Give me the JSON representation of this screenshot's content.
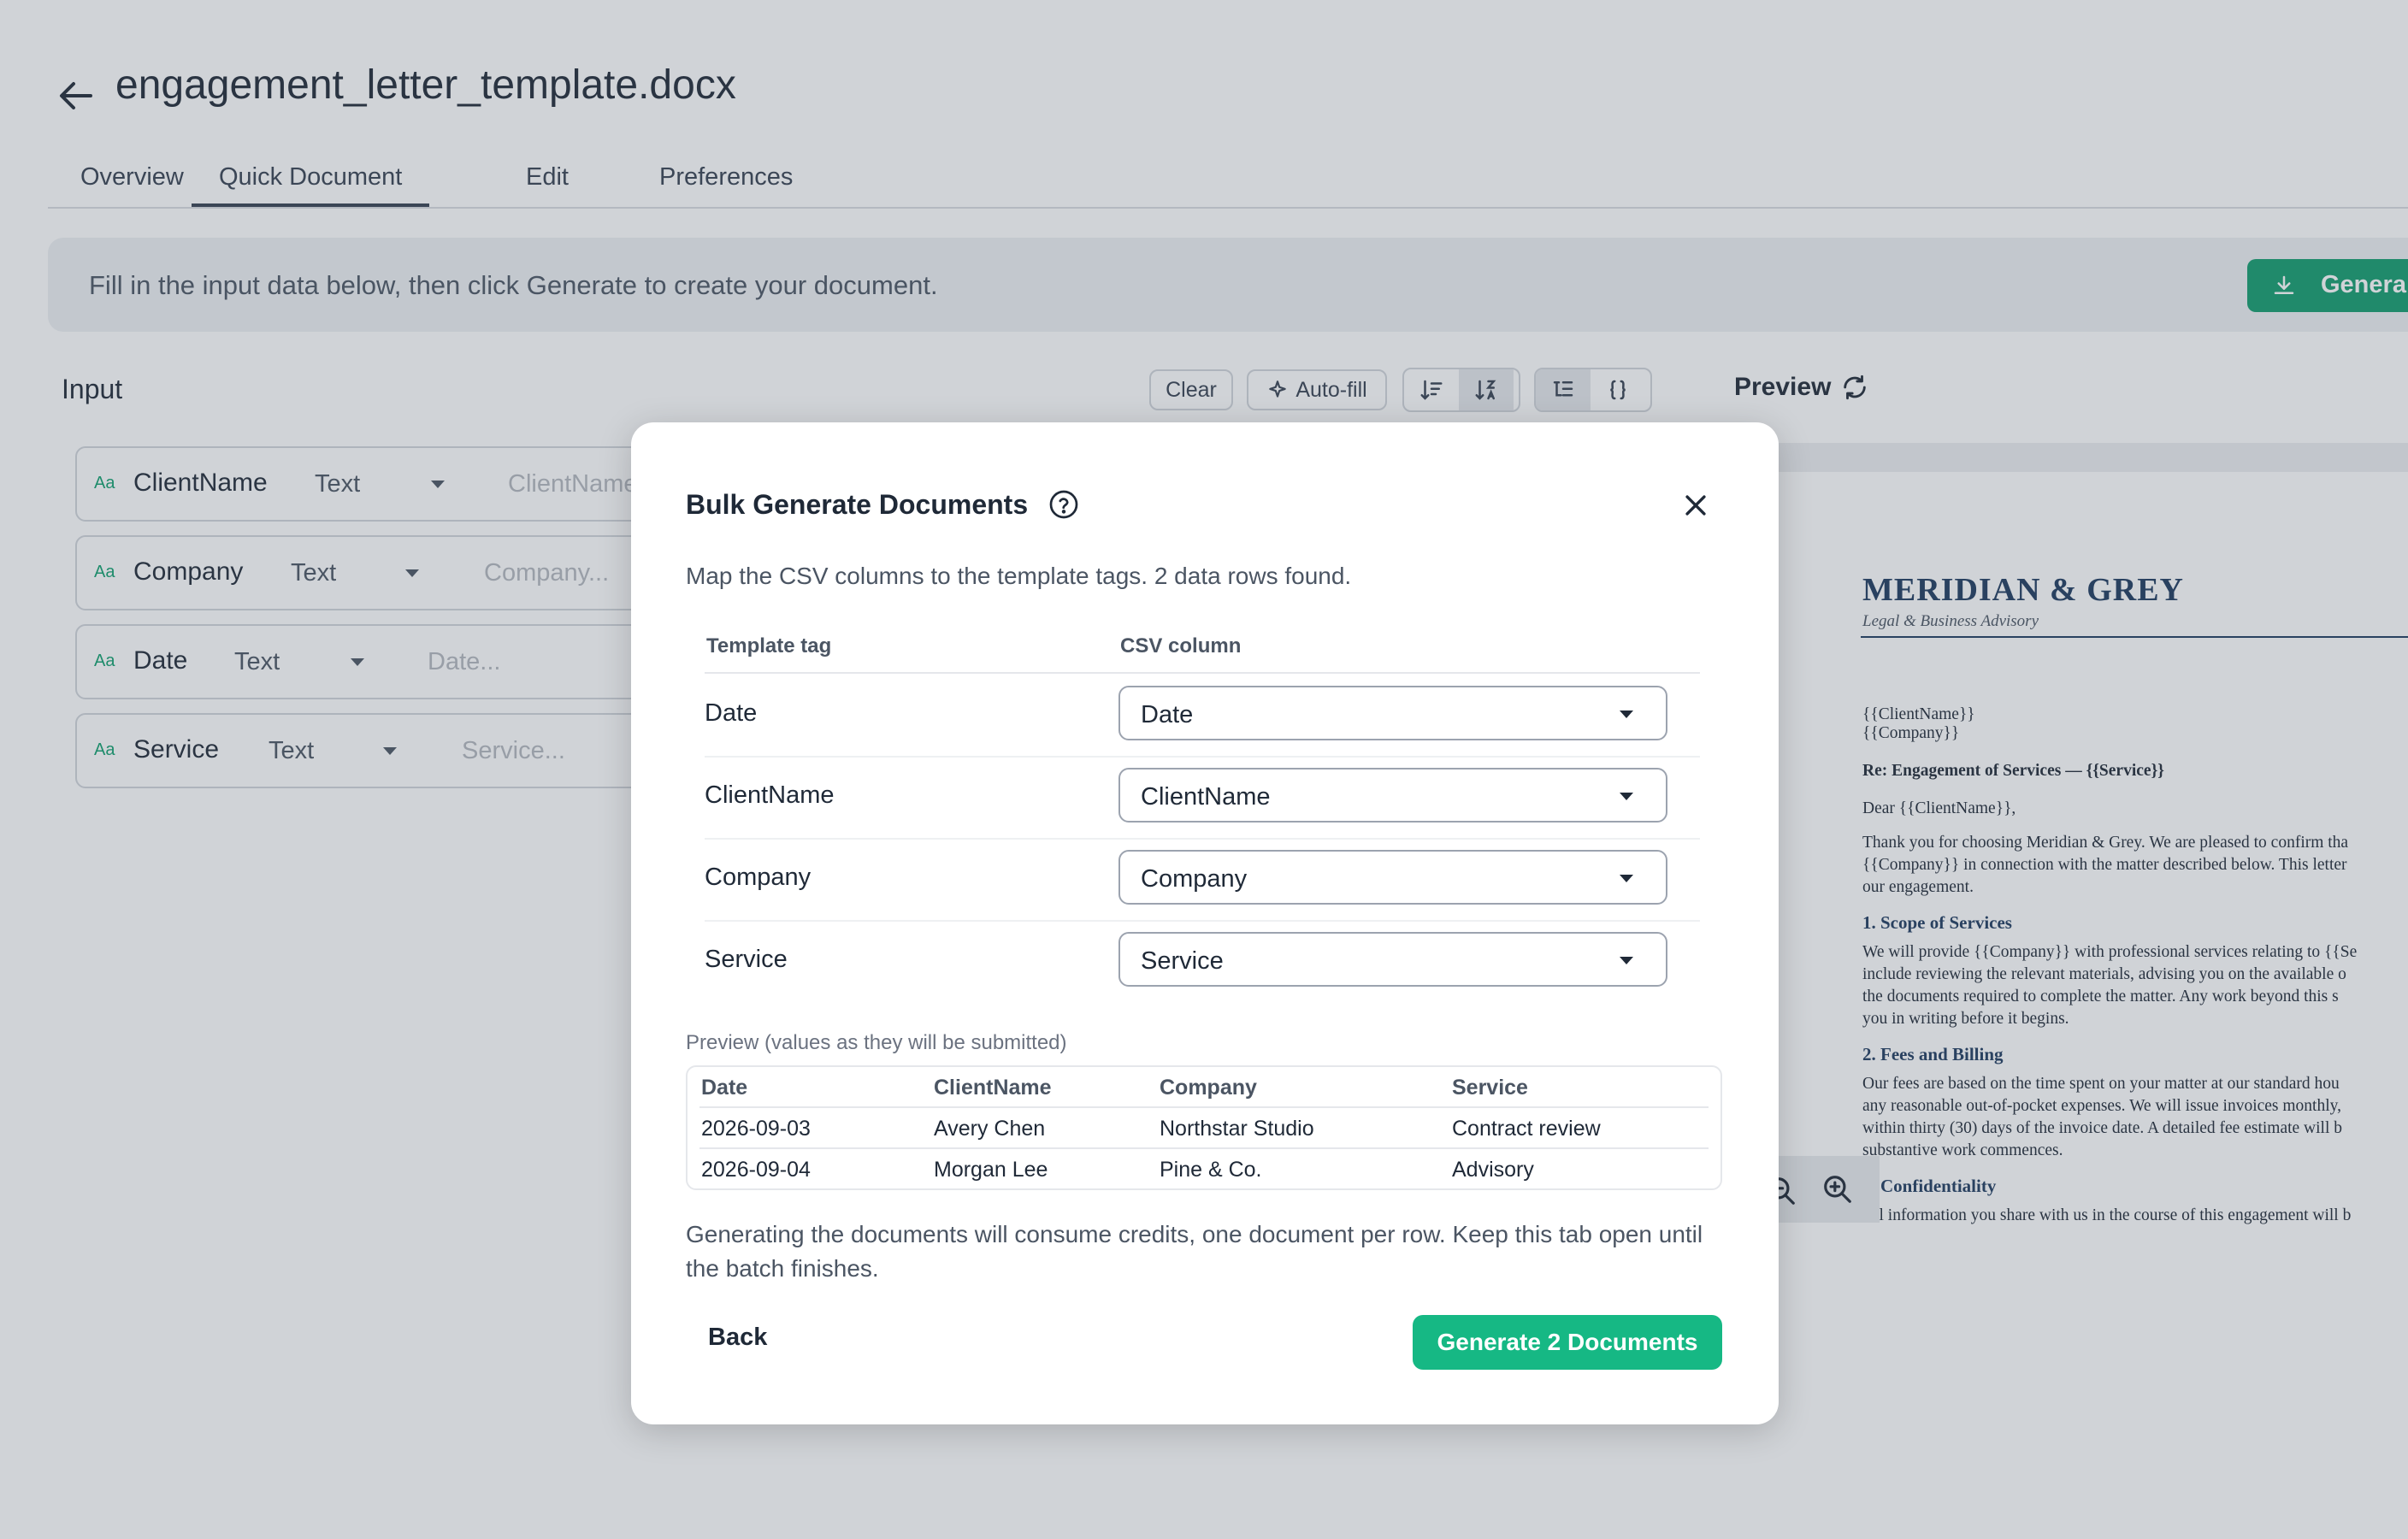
{
  "header": {
    "title": "engagement_letter_template.docx",
    "back_icon": "arrow-left-icon"
  },
  "tabs": [
    {
      "label": "Overview",
      "active": false
    },
    {
      "label": "Quick Document",
      "active": true
    },
    {
      "label": "Edit",
      "active": false
    },
    {
      "label": "Preferences",
      "active": false
    }
  ],
  "banner": {
    "text": "Fill in the input data below, then click Generate to create your document.",
    "generate_label": "Genera",
    "generate_icon": "download-icon",
    "accent": "#129d6e"
  },
  "input": {
    "heading": "Input",
    "toolbar": {
      "clear": "Clear",
      "autofill": "Auto-fill",
      "autofill_icon": "sparkle-icon",
      "sort_icons": [
        "sort-descending-icon",
        "sort-alpha-icon"
      ],
      "view_icons": [
        "list-tree-icon",
        "braces-icon"
      ]
    },
    "fields": [
      {
        "badge": "Aa",
        "name": "ClientName",
        "type": "Text",
        "placeholder": "ClientName..."
      },
      {
        "badge": "Aa",
        "name": "Company",
        "type": "Text",
        "placeholder": "Company..."
      },
      {
        "badge": "Aa",
        "name": "Date",
        "type": "Text",
        "placeholder": "Date..."
      },
      {
        "badge": "Aa",
        "name": "Service",
        "type": "Text",
        "placeholder": "Service..."
      }
    ]
  },
  "preview": {
    "heading": "Preview",
    "refresh_icon": "refresh-icon",
    "zoom_icons": [
      "zoom-out-icon",
      "zoom-in-icon"
    ],
    "document": {
      "brand": "MERIDIAN & GREY",
      "brand_sub": "Legal & Business Advisory",
      "lines": [
        {
          "text": "{{ClientName}}",
          "style": ""
        },
        {
          "text": "{{Company}}",
          "style": ""
        },
        {
          "text": "Re: Engagement of Services — {{Service}}",
          "style": "b"
        },
        {
          "text": "Dear {{ClientName}},",
          "style": ""
        },
        {
          "text": "Thank you for choosing Meridian & Grey. We are pleased to confirm tha",
          "style": ""
        },
        {
          "text": "{{Company}} in connection with the matter described below. This letter",
          "style": ""
        },
        {
          "text": "our engagement.",
          "style": ""
        },
        {
          "text": "1. Scope of Services",
          "style": "h"
        },
        {
          "text": "We will provide {{Company}} with professional services relating to {{Se",
          "style": ""
        },
        {
          "text": "include reviewing the relevant materials, advising you on the available o",
          "style": ""
        },
        {
          "text": "the documents required to complete the matter. Any work beyond this s",
          "style": ""
        },
        {
          "text": "you in writing before it begins.",
          "style": ""
        },
        {
          "text": "2. Fees and Billing",
          "style": "h"
        },
        {
          "text": "Our fees are based on the time spent on your matter at our standard hou",
          "style": ""
        },
        {
          "text": "any reasonable out-of-pocket expenses. We will issue invoices monthly,",
          "style": ""
        },
        {
          "text": "within thirty (30) days of the invoice date. A detailed fee estimate will b",
          "style": ""
        },
        {
          "text": "substantive work commences.",
          "style": ""
        },
        {
          "text": "3. Confidentiality",
          "style": "h"
        },
        {
          "text": "All information you share with us in the course of this engagement will b",
          "style": ""
        }
      ]
    }
  },
  "modal": {
    "title": "Bulk Generate Documents",
    "help_icon": "help-circle-icon",
    "close_icon": "close-icon",
    "subtitle": "Map the CSV columns to the template tags. 2 data rows found.",
    "mapping_headers": {
      "tag": "Template tag",
      "column": "CSV column"
    },
    "mappings": [
      {
        "tag": "Date",
        "column": "Date"
      },
      {
        "tag": "ClientName",
        "column": "ClientName"
      },
      {
        "tag": "Company",
        "column": "Company"
      },
      {
        "tag": "Service",
        "column": "Service"
      }
    ],
    "preview_label": "Preview (values as they will be submitted)",
    "preview_headers": [
      "Date",
      "ClientName",
      "Company",
      "Service"
    ],
    "preview_rows": [
      [
        "2026-09-03",
        "Avery Chen",
        "Northstar Studio",
        "Contract review"
      ],
      [
        "2026-09-04",
        "Morgan Lee",
        "Pine & Co.",
        "Advisory"
      ]
    ],
    "note": "Generating the documents will consume credits, one document per row. Keep this tab open until the batch finishes.",
    "back_label": "Back",
    "generate_label": "Generate 2 Documents",
    "generate_color": "#16b884"
  }
}
